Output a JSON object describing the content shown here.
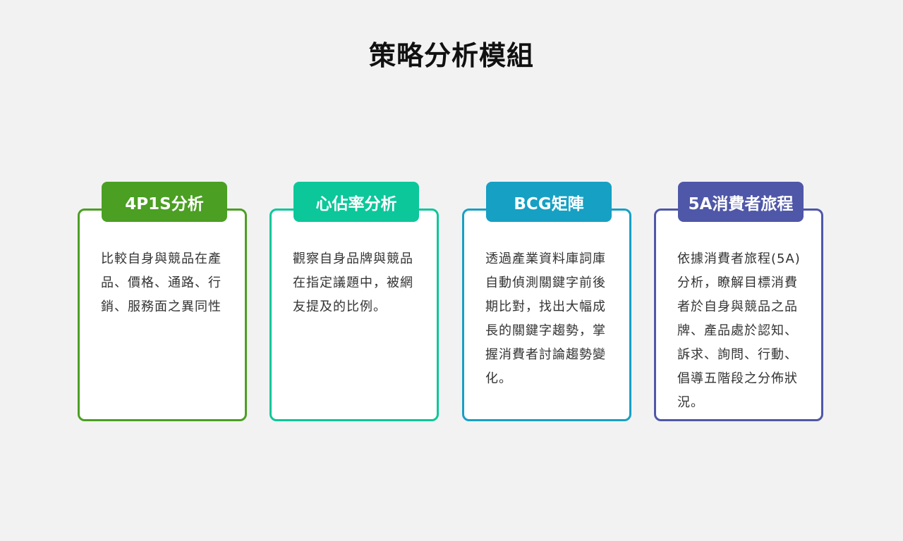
{
  "page": {
    "title": "策略分析模組"
  },
  "colors": {
    "card1": "#4b9f23",
    "card2": "#0cc79a",
    "card3": "#16a0c4",
    "card4": "#4f57a8",
    "background": "#f2f2f2"
  },
  "cards": [
    {
      "title": "4P1S分析",
      "body": "比較自身與競品在產品、價格、通路、行銷、服務面之異同性"
    },
    {
      "title": "心佔率分析",
      "body": "觀察自身品牌與競品在指定議題中，被網友提及的比例。"
    },
    {
      "title": "BCG矩陣",
      "body": "透過產業資料庫詞庫自動偵測關鍵字前後期比對，找出大幅成長的關鍵字趨勢，掌握消費者討論趨勢變化。"
    },
    {
      "title": "5A消費者旅程",
      "body": "依據消費者旅程(5A)分析，瞭解目標消費者於自身與競品之品牌、產品處於認知、訴求、詢問、行動、倡導五階段之分佈狀況。"
    }
  ]
}
